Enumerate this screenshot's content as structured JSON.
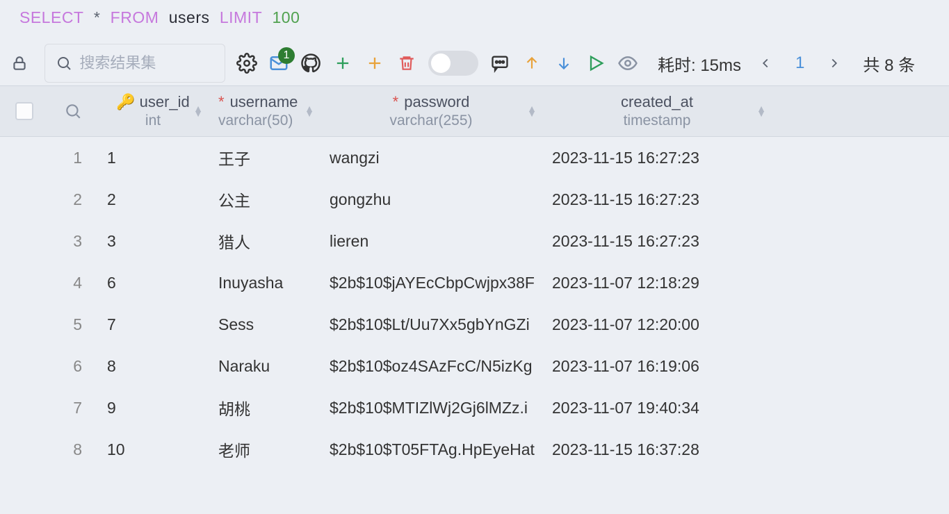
{
  "sql": {
    "select": "SELECT",
    "star": "*",
    "from": "FROM",
    "table": "users",
    "limit": "LIMIT",
    "num": "100"
  },
  "toolbar": {
    "search_placeholder": "搜索结果集",
    "mail_badge": "1",
    "elapsed": "耗时: 15ms",
    "page": "1",
    "total_prefix": "共",
    "total_count": "8",
    "total_suffix": "条"
  },
  "columns": [
    {
      "name": "user_id",
      "type": "int",
      "pk": true,
      "required": false
    },
    {
      "name": "username",
      "type": "varchar(50)",
      "pk": false,
      "required": true
    },
    {
      "name": "password",
      "type": "varchar(255)",
      "pk": false,
      "required": true
    },
    {
      "name": "created_at",
      "type": "timestamp",
      "pk": false,
      "required": false
    }
  ],
  "rows": [
    {
      "n": "1",
      "user_id": "1",
      "username": "王子",
      "password": "wangzi",
      "created_at": "2023-11-15 16:27:23"
    },
    {
      "n": "2",
      "user_id": "2",
      "username": "公主",
      "password": "gongzhu",
      "created_at": "2023-11-15 16:27:23"
    },
    {
      "n": "3",
      "user_id": "3",
      "username": "猎人",
      "password": "lieren",
      "created_at": "2023-11-15 16:27:23"
    },
    {
      "n": "4",
      "user_id": "6",
      "username": "Inuyasha",
      "password": "$2b$10$jAYEcCbpCwjpx38F",
      "created_at": "2023-11-07 12:18:29"
    },
    {
      "n": "5",
      "user_id": "7",
      "username": "Sess",
      "password": "$2b$10$Lt/Uu7Xx5gbYnGZi",
      "created_at": "2023-11-07 12:20:00"
    },
    {
      "n": "6",
      "user_id": "8",
      "username": "Naraku",
      "password": "$2b$10$oz4SAzFcC/N5izKg",
      "created_at": "2023-11-07 16:19:06"
    },
    {
      "n": "7",
      "user_id": "9",
      "username": "胡桃",
      "password": "$2b$10$MTIZlWj2Gj6lMZz.i",
      "created_at": "2023-11-07 19:40:34"
    },
    {
      "n": "8",
      "user_id": "10",
      "username": "老师",
      "password": "$2b$10$T05FTAg.HpEyeHat",
      "created_at": "2023-11-15 16:37:28"
    }
  ]
}
